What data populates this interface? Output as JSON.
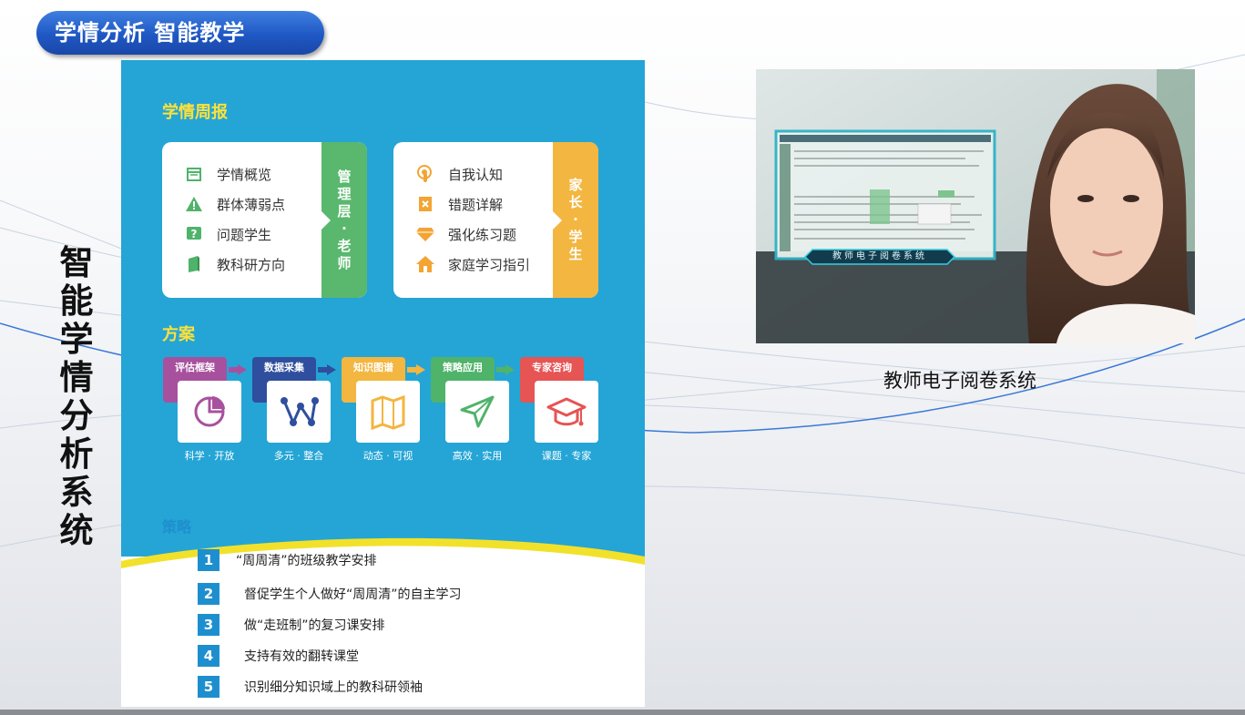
{
  "header": {
    "title": "学情分析  智能教学"
  },
  "side_title": [
    "智",
    "能",
    "学",
    "情",
    "分",
    "析",
    "系",
    "统"
  ],
  "poster": {
    "weekly_report_title": "学情周报",
    "management_card": {
      "items": [
        {
          "icon": "calendar-icon",
          "label": "学情概览"
        },
        {
          "icon": "warning-icon",
          "label": "群体薄弱点"
        },
        {
          "icon": "question-icon",
          "label": "问题学生"
        },
        {
          "icon": "book-icon",
          "label": "教科研方向"
        }
      ],
      "tag_chars": [
        "管",
        "理",
        "层",
        "·",
        "老",
        "师"
      ],
      "tag_color": "#59b86d"
    },
    "parent_card": {
      "items": [
        {
          "icon": "touch-icon",
          "label": "自我认知"
        },
        {
          "icon": "error-icon",
          "label": "错题详解"
        },
        {
          "icon": "diamond-icon",
          "label": "强化练习题"
        },
        {
          "icon": "home-icon",
          "label": "家庭学习指引"
        }
      ],
      "tag_chars": [
        "家",
        "长",
        "·",
        "学",
        "生"
      ],
      "tag_color": "#f3b640"
    },
    "plan_title": "方案",
    "steps": [
      {
        "label": "评估框架",
        "color": "#a7519e",
        "caption": "科学 · 开放",
        "icon": "pie-chart-icon"
      },
      {
        "label": "数据采集",
        "color": "#2f4f9e",
        "caption": "多元 · 整合",
        "icon": "network-icon"
      },
      {
        "label": "知识图谱",
        "color": "#f3b640",
        "caption": "动态 · 可视",
        "icon": "map-icon"
      },
      {
        "label": "策略应用",
        "color": "#4fb36a",
        "caption": "高效 · 实用",
        "icon": "send-icon"
      },
      {
        "label": "专家咨询",
        "color": "#e65454",
        "caption": "课题 · 专家",
        "icon": "graduation-cap-icon"
      }
    ],
    "strategy_title": "策略",
    "strategies": [
      {
        "num": "1",
        "text": "“周周清”的班级教学安排"
      },
      {
        "num": "2",
        "text": "督促学生个人做好“周周清”的自主学习"
      },
      {
        "num": "3",
        "text": "做“走班制”的复习课安排"
      },
      {
        "num": "4",
        "text": "支持有效的翻转课堂"
      },
      {
        "num": "5",
        "text": "识别细分知识域上的教科研领袖"
      }
    ]
  },
  "photo": {
    "overlay_label": "教师电子阅卷系统",
    "caption": "教师电子阅卷系统"
  },
  "colors": {
    "poster_blue": "#24a5d6",
    "accent_yellow": "#ffe13a",
    "title_blue": "#1f58c4",
    "strategy_blue": "#1e8fce"
  }
}
